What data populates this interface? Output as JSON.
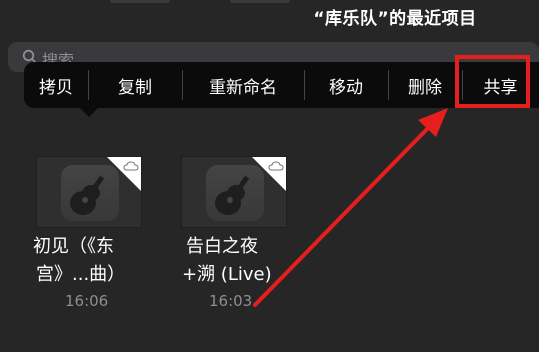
{
  "header": {
    "title": "“库乐队”的最近项目"
  },
  "search": {
    "placeholder": "搜索"
  },
  "context_menu": {
    "items": [
      {
        "label": "拷贝"
      },
      {
        "label": "复制"
      },
      {
        "label": "重新命名"
      },
      {
        "label": "移动"
      },
      {
        "label": "删除"
      },
      {
        "label": "共享"
      }
    ]
  },
  "files": [
    {
      "name_line1": "初见（《东",
      "name_line2": "宫》...曲）",
      "time": "16:06"
    },
    {
      "name_line1": "告白之夜",
      "name_line2": "+溯 (Live)",
      "time": "16:03"
    }
  ],
  "annotation": {
    "color": "#e61e1e"
  }
}
